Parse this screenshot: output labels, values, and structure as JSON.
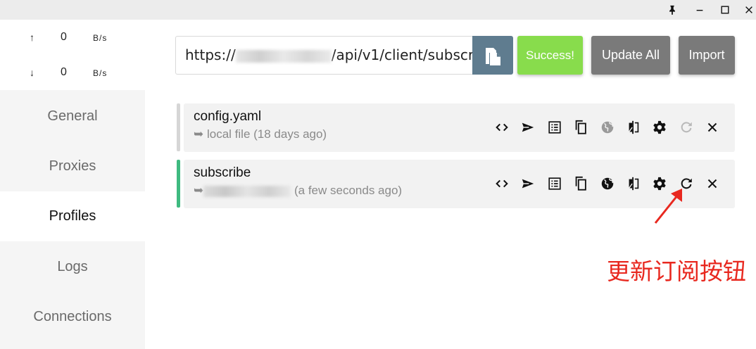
{
  "window": {
    "controls": [
      {
        "name": "pin-icon",
        "glyph": "pin"
      },
      {
        "name": "minimize-icon",
        "glyph": "minimize"
      },
      {
        "name": "maximize-icon",
        "glyph": "maximize"
      },
      {
        "name": "close-icon",
        "glyph": "close"
      }
    ]
  },
  "traffic": {
    "up": {
      "arrow": "↑",
      "value": "0",
      "unit": "B/s"
    },
    "down": {
      "arrow": "↓",
      "value": "0",
      "unit": "B/s"
    }
  },
  "sidebar": {
    "items": [
      {
        "label": "General",
        "active": false
      },
      {
        "label": "Proxies",
        "active": false
      },
      {
        "label": "Profiles",
        "active": true
      },
      {
        "label": "Logs",
        "active": false
      },
      {
        "label": "Connections",
        "active": false
      }
    ]
  },
  "header": {
    "url_prefix": "https://",
    "url_suffix": "/api/v1/client/subscr",
    "success_label": "Success!",
    "update_all_label": "Update All",
    "import_label": "Import",
    "colors": {
      "success": "#88dc4c",
      "paste": "#5f7c8f",
      "neutral": "#7a7a7a"
    }
  },
  "profiles": [
    {
      "name": "config.yaml",
      "arrow": "➥",
      "source": "local file",
      "time": "(18 days ago)",
      "indicator_color": "#d6d6d6",
      "update_enabled": false
    },
    {
      "name": "subscribe",
      "arrow": "➥",
      "source": "",
      "time": "(a few seconds ago)",
      "indicator_color": "#3fba80",
      "update_enabled": true
    }
  ],
  "profile_actions": [
    "code-icon",
    "send-icon",
    "list-icon",
    "copy-icon",
    "globe-icon",
    "compare-icon",
    "gear-icon",
    "refresh-icon",
    "close-icon"
  ],
  "annotation": {
    "text": "更新订阅按钮",
    "color": "#e8281f"
  }
}
